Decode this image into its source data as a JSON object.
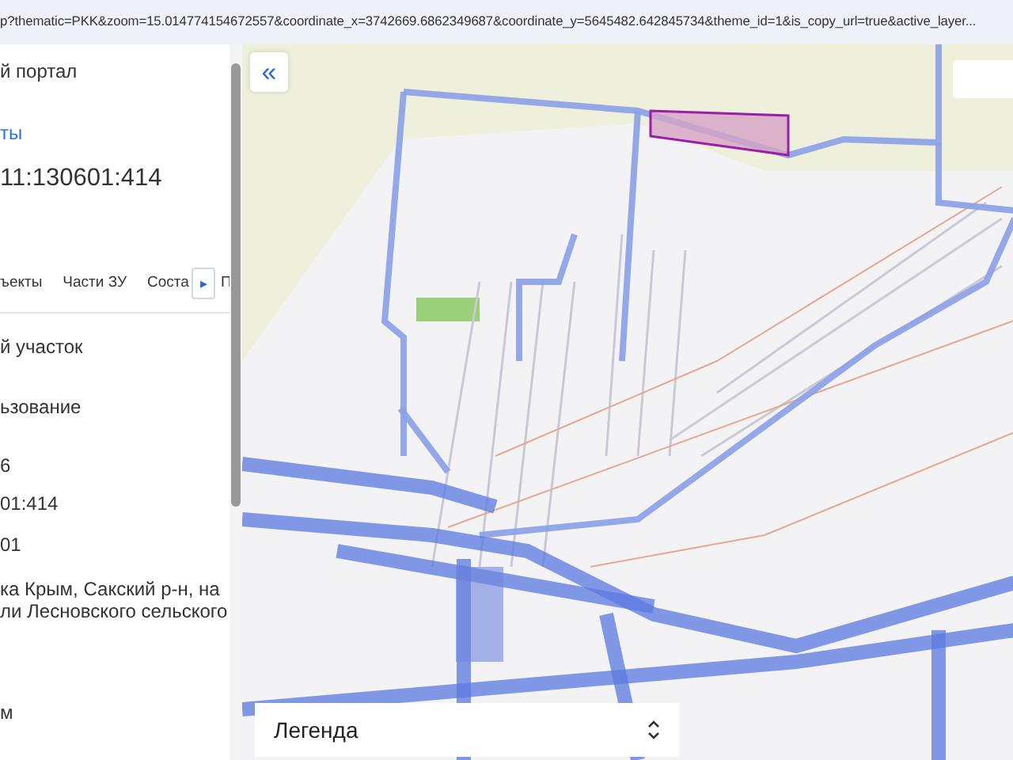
{
  "address_bar": {
    "url": "p?thematic=PKK&zoom=15.014774154672557&coordinate_x=3742669.6862349687&coordinate_y=5645482.642845734&theme_id=1&is_copy_url=true&active_layer..."
  },
  "panel": {
    "portal_title": "й портал",
    "link": "ты",
    "cadastral_number": "11:130601:414",
    "tabs": [
      {
        "label": "ъекты"
      },
      {
        "label": "Части ЗУ"
      },
      {
        "label": "Соста"
      },
      {
        "label": "П"
      }
    ],
    "tab_scroll": "▸",
    "fields": [
      {
        "value": "й участок"
      },
      {
        "value": "ьзование"
      },
      {
        "value": "6"
      },
      {
        "value": "01:414"
      },
      {
        "value": "01"
      },
      {
        "value": "ка Крым, Сакский р-н, на"
      },
      {
        "value": "ли Лесновского сельского"
      },
      {
        "value": "м"
      }
    ]
  },
  "map": {
    "collapse_button": "«",
    "legend": {
      "label": "Легенда"
    }
  }
}
